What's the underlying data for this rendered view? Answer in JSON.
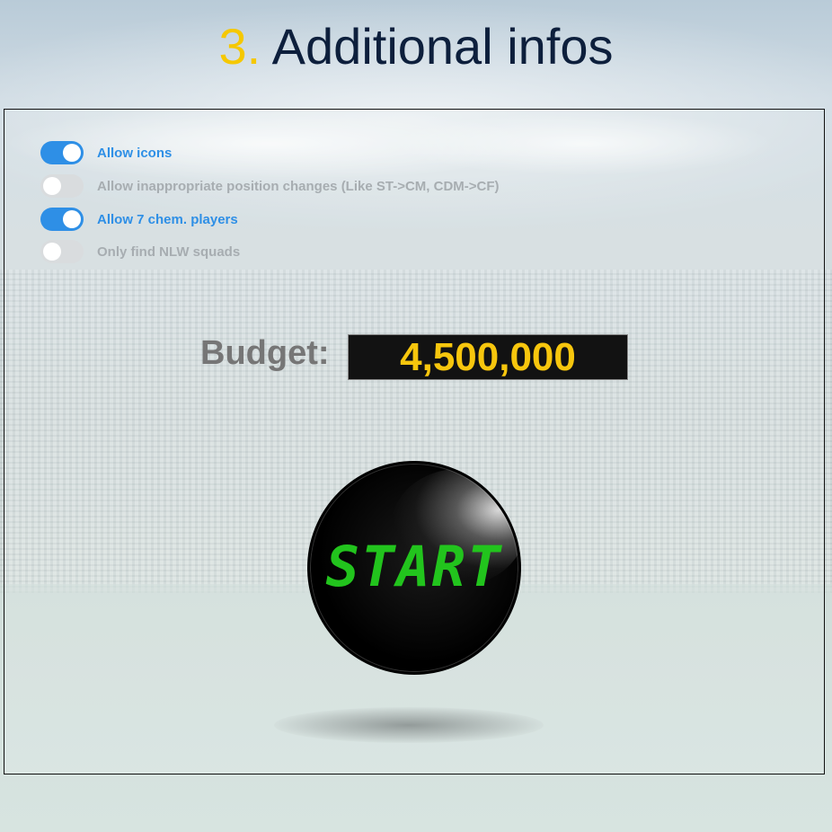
{
  "header": {
    "step_number": "3.",
    "title": "Additional infos"
  },
  "options": [
    {
      "label": "Allow icons",
      "enabled": true
    },
    {
      "label": "Allow inappropriate position changes (Like ST->CM, CDM->CF)",
      "enabled": false
    },
    {
      "label": "Allow 7 chem. players",
      "enabled": true
    },
    {
      "label": "Only find NLW squads",
      "enabled": false
    }
  ],
  "budget": {
    "label": "Budget:",
    "value": "4,500,000"
  },
  "start_button": {
    "label": "START"
  },
  "colors": {
    "accent_blue": "#2e8fe6",
    "title_navy": "#0d1f3c",
    "step_yellow": "#f5c800",
    "budget_yellow": "#f7c60d",
    "start_green": "#22c41d"
  }
}
